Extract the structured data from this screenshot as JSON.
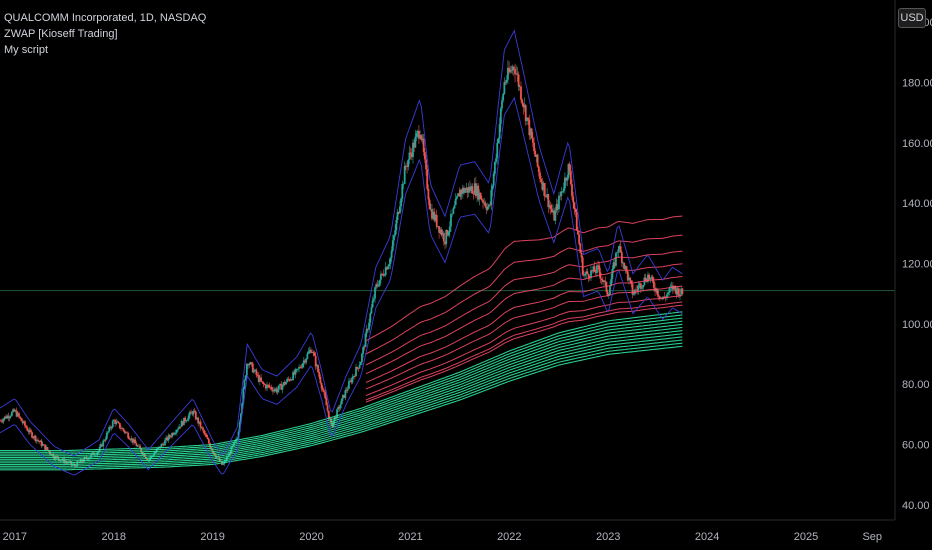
{
  "header": {
    "symbol_line": "QUALCOMM Incorporated, 1D, NASDAQ",
    "indicator_1": "ZWAP [Kioseff Trading]",
    "indicator_2": "My script"
  },
  "currency_button": "USD",
  "colors": {
    "background": "#000000",
    "candle_up": "#26a69a",
    "candle_down": "#ef5350",
    "band_red": "#ff4d6d",
    "band_green": "#2ee6a0",
    "envelope": "#3b3bd9",
    "crosshair_line": "#1f5a3a"
  },
  "chart_data": {
    "type": "candlestick",
    "y_axis_ticks": [
      "200.00",
      "180.00",
      "160.00",
      "140.00",
      "120.00",
      "100.00",
      "80.00",
      "60.00",
      "40.00"
    ],
    "y_axis_tick_values": [
      200,
      180,
      160,
      140,
      120,
      100,
      80,
      60,
      40
    ],
    "x_axis_ticks": [
      "2017",
      "2018",
      "2019",
      "2020",
      "2021",
      "2022",
      "2023",
      "2024",
      "2025",
      "Sep"
    ],
    "x_axis_tick_times": [
      2017.0,
      2018.0,
      2019.0,
      2020.0,
      2021.0,
      2022.0,
      2023.0,
      2024.0,
      2025.0,
      2025.67
    ],
    "ylim": [
      35,
      204
    ],
    "xlim": [
      2016.85,
      2025.9
    ],
    "horizontal_line_price": 111,
    "price_path": [
      [
        2016.85,
        68
      ],
      [
        2017.0,
        71
      ],
      [
        2017.15,
        64
      ],
      [
        2017.4,
        56
      ],
      [
        2017.6,
        53
      ],
      [
        2017.85,
        58
      ],
      [
        2018.0,
        68
      ],
      [
        2018.15,
        63
      ],
      [
        2018.35,
        55
      ],
      [
        2018.6,
        64
      ],
      [
        2018.8,
        71
      ],
      [
        2019.0,
        58
      ],
      [
        2019.1,
        53
      ],
      [
        2019.25,
        62
      ],
      [
        2019.35,
        88
      ],
      [
        2019.5,
        80
      ],
      [
        2019.65,
        78
      ],
      [
        2019.85,
        84
      ],
      [
        2020.0,
        92
      ],
      [
        2020.1,
        80
      ],
      [
        2020.2,
        66
      ],
      [
        2020.35,
        78
      ],
      [
        2020.5,
        88
      ],
      [
        2020.65,
        112
      ],
      [
        2020.8,
        122
      ],
      [
        2020.95,
        152
      ],
      [
        2021.1,
        165
      ],
      [
        2021.2,
        138
      ],
      [
        2021.35,
        128
      ],
      [
        2021.5,
        144
      ],
      [
        2021.65,
        145
      ],
      [
        2021.8,
        138
      ],
      [
        2021.95,
        180
      ],
      [
        2022.05,
        186
      ],
      [
        2022.15,
        172
      ],
      [
        2022.3,
        150
      ],
      [
        2022.45,
        135
      ],
      [
        2022.6,
        152
      ],
      [
        2022.75,
        116
      ],
      [
        2022.9,
        118
      ],
      [
        2023.0,
        110
      ],
      [
        2023.1,
        126
      ],
      [
        2023.25,
        110
      ],
      [
        2023.4,
        116
      ],
      [
        2023.55,
        108
      ],
      [
        2023.65,
        112
      ],
      [
        2023.75,
        110
      ]
    ],
    "red_band_offsets": [
      1.3,
      1.24,
      1.19,
      1.15,
      1.11,
      1.08,
      1.05,
      1.03,
      1.02
    ],
    "green_band_offsets": [
      1.0,
      0.99,
      0.98,
      0.97,
      0.96,
      0.95,
      0.94,
      0.93,
      0.92,
      0.91,
      0.9,
      0.89
    ],
    "baseline_path": [
      [
        2016.85,
        58
      ],
      [
        2017.5,
        58
      ],
      [
        2018.0,
        58.5
      ],
      [
        2018.5,
        59
      ],
      [
        2019.0,
        60
      ],
      [
        2019.5,
        63
      ],
      [
        2020.0,
        67
      ],
      [
        2020.5,
        72
      ],
      [
        2021.0,
        78
      ],
      [
        2021.5,
        84
      ],
      [
        2022.0,
        91
      ],
      [
        2022.5,
        97
      ],
      [
        2023.0,
        101
      ],
      [
        2023.5,
        103
      ],
      [
        2023.75,
        104
      ]
    ],
    "red_start": 2020.55
  }
}
